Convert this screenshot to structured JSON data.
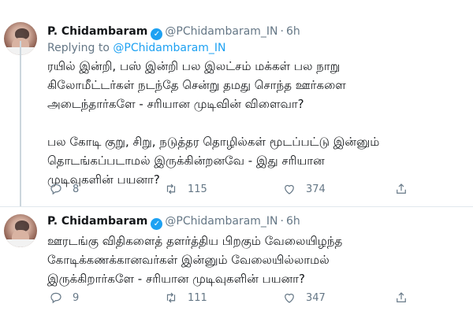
{
  "tweets": [
    {
      "author_name": "P. Chidambaram",
      "handle": "@PChidambaram_IN",
      "separator": "·",
      "time": "6h",
      "replying_prefix": "Replying to",
      "replying_to": "@PChidambaram_IN",
      "lines": [
        "ரயில் இன்றி, பஸ் இன்றி பல இலட்சம் மக்கள் பல நாறு",
        "கிலோமீட்டர்கள் நடந்தே சென்று தமது சொந்த ஊர்களை",
        "அடைந்தார்களே - சரியான முடிவின் விளைவா?",
        "",
        "பல கோடி குறு, சிறு, நடுத்தர தொழில்கள் மூடப்பட்டு இன்னும்",
        "தொடங்கப்படாமல் இருக்கின்றனவே - இது சரியான",
        "முடிவுகளின் பயனா?"
      ],
      "actions": {
        "replies": "8",
        "retweets": "115",
        "likes": "374"
      }
    },
    {
      "author_name": "P. Chidambaram",
      "handle": "@PChidambaram_IN",
      "separator": "·",
      "time": "6h",
      "lines": [
        "ஊரடங்கு விதிகளைத் தளர்த்திய பிறகும் வேலையிழந்த",
        "கோடிக்கணக்கானவர்கள் இன்னும் வேலையில்லாமல்",
        "இருக்கிறார்களே - சரியான முடிவுகளின் பயனா?"
      ],
      "actions": {
        "replies": "9",
        "retweets": "111",
        "likes": "347"
      }
    }
  ],
  "icons": {
    "verified": "verified-badge-icon",
    "reply": "reply-icon",
    "retweet": "retweet-icon",
    "like": "heart-icon",
    "share": "share-icon"
  },
  "colors": {
    "accent": "#1da1f2",
    "muted": "#657786",
    "text": "#14171a"
  }
}
